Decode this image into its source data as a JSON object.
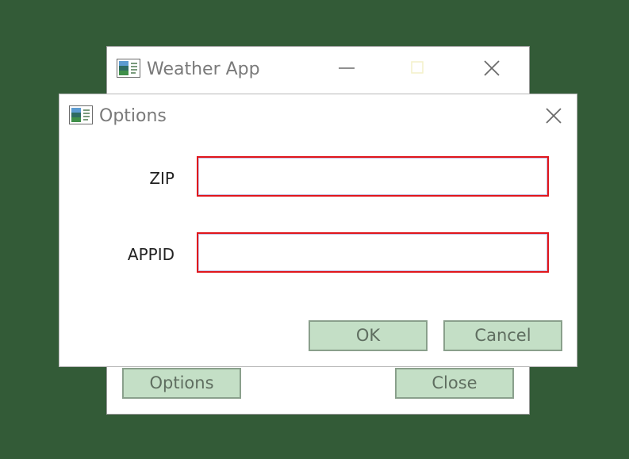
{
  "main_window": {
    "title": "Weather App",
    "icon": "app-icon",
    "buttons": {
      "options_label": "Options",
      "close_label": "Close"
    }
  },
  "dialog": {
    "title": "Options",
    "icon": "app-icon",
    "fields": {
      "zip": {
        "label": "ZIP",
        "value": "",
        "placeholder": ""
      },
      "appid": {
        "label": "APPID",
        "value": "",
        "placeholder": ""
      }
    },
    "buttons": {
      "ok_label": "OK",
      "cancel_label": "Cancel"
    }
  },
  "colors": {
    "desktop_background": "#335b37",
    "button_fill": "#c4dfc6",
    "invalid_field_border": "#e0161c"
  }
}
